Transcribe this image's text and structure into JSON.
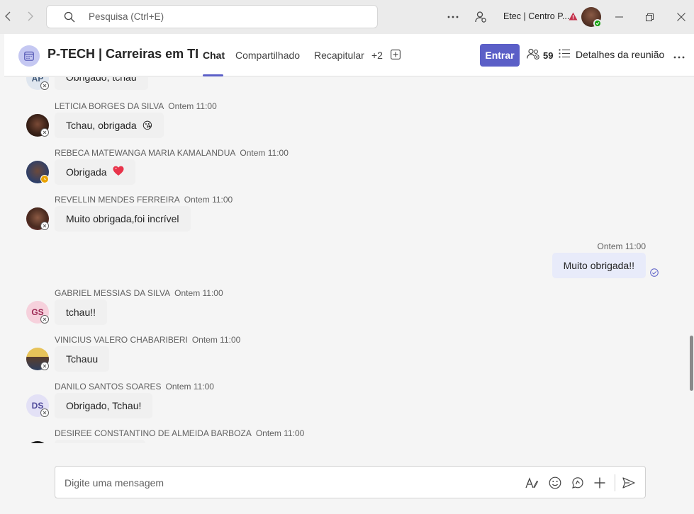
{
  "titlebar": {
    "search_placeholder": "Pesquisa (Ctrl+E)",
    "org_name": "Etec | Centro P...",
    "accent_warning": "#c4314b"
  },
  "header": {
    "title": "P-TECH | Carreiras em TI",
    "tabs": [
      {
        "label": "Chat",
        "active": true
      },
      {
        "label": "Compartilhado",
        "active": false
      },
      {
        "label": "Recapitular",
        "active": false
      },
      {
        "label": "+2",
        "active": false
      }
    ],
    "join_label": "Entrar",
    "participants_count": "59",
    "details_label": "Detalhes da reunião",
    "accent": "#5b5fc7"
  },
  "messages": [
    {
      "initials": "AP",
      "sender": "",
      "time": "",
      "text": "Obrigado, tchau",
      "emoji": "",
      "avatar": "initials"
    },
    {
      "initials": "",
      "sender": "LETICIA BORGES DA SILVA",
      "time": "Ontem 11:00",
      "text": "Tchau, obrigada",
      "emoji": "😘",
      "avatar": "photo"
    },
    {
      "initials": "",
      "sender": "REBECA MATEWANGA MARIA KAMALANDUA",
      "time": "Ontem 11:00",
      "text": "Obrigada",
      "emoji": "❤️",
      "avatar": "photo"
    },
    {
      "initials": "",
      "sender": "REVELLIN MENDES FERREIRA",
      "time": "Ontem 11:00",
      "text": "Muito obrigada,foi incrível",
      "emoji": "",
      "avatar": "photo"
    },
    {
      "own": true,
      "time": "Ontem 11:00",
      "text": "Muito obrigada!!"
    },
    {
      "initials": "GS",
      "sender": "GABRIEL MESSIAS DA SILVA",
      "time": "Ontem 11:00",
      "text": "tchau!!",
      "emoji": "",
      "avatar": "initials"
    },
    {
      "initials": "",
      "sender": "VINICIUS VALERO CHABARIBERI",
      "time": "Ontem 11:00",
      "text": "Tchauu",
      "emoji": "",
      "avatar": "photo"
    },
    {
      "initials": "DS",
      "sender": "DANILO SANTOS SOARES",
      "time": "Ontem 11:00",
      "text": "Obrigado, Tchau!",
      "emoji": "",
      "avatar": "initials"
    },
    {
      "initials": "",
      "sender": "DESIREE CONSTANTINO DE ALMEIDA BARBOZA",
      "time": "Ontem 11:00",
      "text": "",
      "emoji": "",
      "avatar": "photo"
    }
  ],
  "compose": {
    "placeholder": "Digite uma mensagem"
  }
}
